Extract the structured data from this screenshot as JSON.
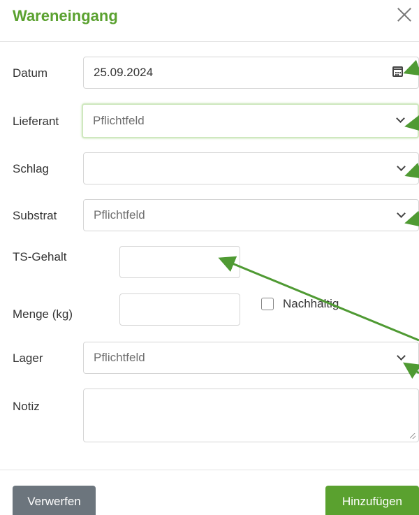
{
  "dialog": {
    "title": "Wareneingang"
  },
  "form": {
    "datum": {
      "label": "Datum",
      "value": "25.09.2024"
    },
    "lieferant": {
      "label": "Lieferant",
      "placeholder": "Pflichtfeld"
    },
    "schlag": {
      "label": "Schlag",
      "value": ""
    },
    "substrat": {
      "label": "Substrat",
      "placeholder": "Pflichtfeld"
    },
    "ts_gehalt": {
      "label": "TS-Gehalt",
      "value": ""
    },
    "menge": {
      "label": "Menge (kg)",
      "value": ""
    },
    "nachhaltig": {
      "label": "Nachhaltig",
      "checked": false
    },
    "lager": {
      "label": "Lager",
      "placeholder": "Pflichtfeld"
    },
    "notiz": {
      "label": "Notiz",
      "value": ""
    }
  },
  "footer": {
    "discard_label": "Verwerfen",
    "add_label": "Hinzufügen"
  },
  "colors": {
    "accent": "#5aa12f",
    "discard": "#6c757d",
    "annotation_arrow": "#4f9a33"
  },
  "icons": [
    "close-icon",
    "calendar-icon",
    "chevron-down-icon"
  ]
}
